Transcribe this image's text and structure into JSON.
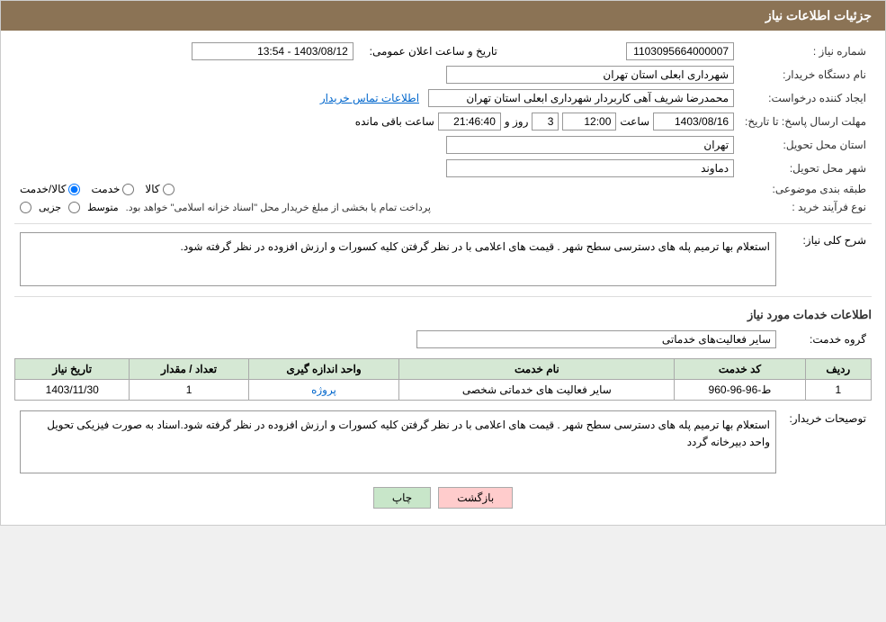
{
  "header": {
    "title": "جزئیات اطلاعات نیاز"
  },
  "fields": {
    "need_number_label": "شماره نیاز :",
    "need_number_value": "1103095664000007",
    "buyer_name_label": "نام دستگاه خریدار:",
    "buyer_name_value": "شهرداری ابعلی استان تهران",
    "creator_label": "ایجاد کننده درخواست:",
    "creator_value": "محمدرضا شریف آهی کاربردار  شهرداری ابعلی استان تهران",
    "creator_link": "اطلاعات تماس خریدار",
    "deadline_label": "مهلت ارسال پاسخ: تا تاریخ:",
    "pub_datetime_label": "تاریخ و ساعت اعلان عمومی:",
    "pub_datetime_value": "1403/08/12 - 13:54",
    "deadline_date": "1403/08/16",
    "deadline_time_label": "ساعت",
    "deadline_time": "12:00",
    "remaining_days_label": "روز و",
    "remaining_days": "3",
    "remaining_time_label": "ساعت باقی مانده",
    "remaining_time": "21:46:40",
    "province_label": "استان محل تحویل:",
    "province_value": "تهران",
    "city_label": "شهر محل تحویل:",
    "city_value": "دماوند",
    "category_label": "طبقه بندی موضوعی:",
    "category_options": [
      "کالا",
      "خدمت",
      "کالا/خدمت"
    ],
    "category_selected": "کالا/خدمت",
    "process_label": "نوع فرآیند خرید :",
    "process_options": [
      "جزیی",
      "متوسط"
    ],
    "process_text": "پرداخت تمام یا بخشی از مبلغ خریدار محل \"اسناد خزانه اسلامی\" خواهد بود.",
    "description_label": "شرح کلی نیاز:",
    "description_value": "استعلام  بها ترمیم پله های دسترسی سطح شهر . قیمت های اعلامی با در نظر گرفتن کلیه کسورات و ارزش افزوده در نظر گرفته شود.",
    "services_section_title": "اطلاعات خدمات مورد نیاز",
    "service_group_label": "گروه خدمت:",
    "service_group_value": "سایر فعالیت‌های خدماتی",
    "services_table": {
      "columns": [
        "ردیف",
        "کد خدمت",
        "نام خدمت",
        "واحد اندازه گیری",
        "تعداد / مقدار",
        "تاریخ نیاز"
      ],
      "rows": [
        {
          "row": "1",
          "code": "ط-96-96-960",
          "name": "سایر فعالیت های خدماتی شخصی",
          "unit": "پروژه",
          "qty": "1",
          "date": "1403/11/30"
        }
      ]
    },
    "buyer_desc_label": "توصیحات خریدار:",
    "buyer_desc_value": "استعلام  بها ترمیم پله های دسترسی سطح شهر . قیمت های اعلامی با در نظر گرفتن کلیه کسورات و ارزش افزوده در نظر گرفته شود.اسناد به صورت فیزیکی تحویل واحد دبیرخانه گردد"
  },
  "buttons": {
    "print": "چاپ",
    "back": "بازگشت"
  }
}
